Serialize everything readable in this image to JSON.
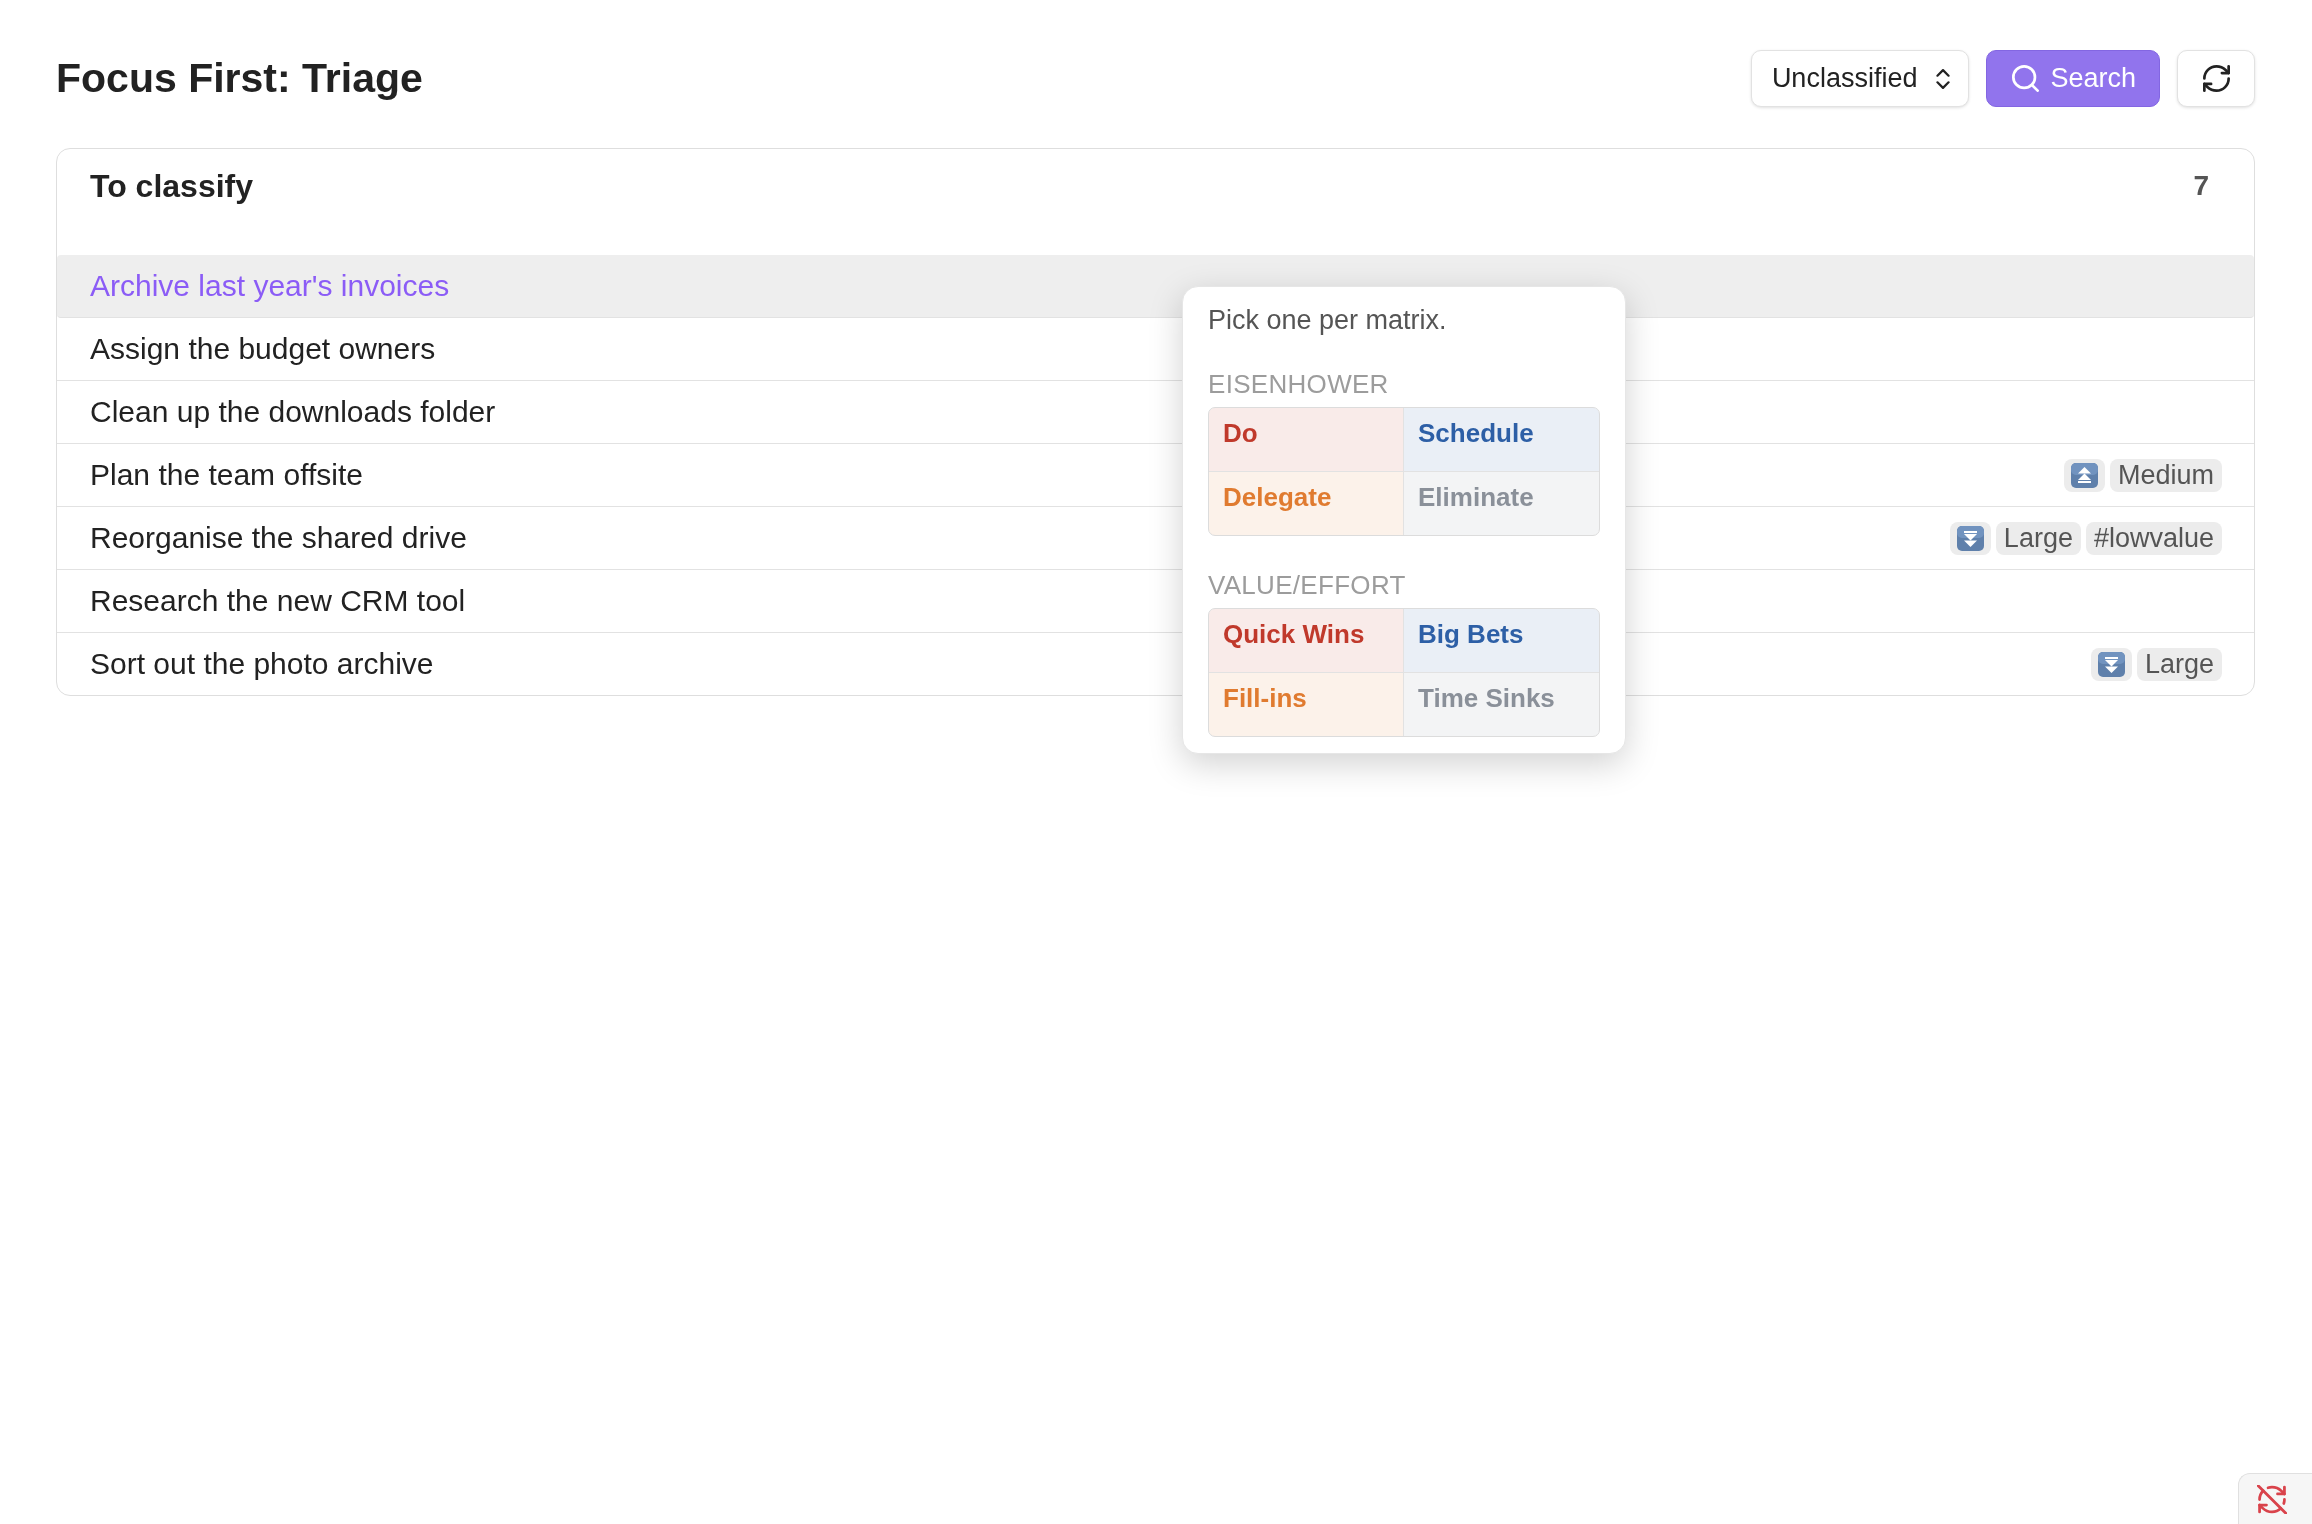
{
  "header": {
    "title": "Focus First: Triage",
    "filter": {
      "value": "Unclassified"
    },
    "search_button": "Search"
  },
  "card": {
    "title": "To classify",
    "count": "7",
    "rows": [
      {
        "title": "Archive last year's invoices",
        "selected": true
      },
      {
        "title": "Assign the budget owners",
        "selected": false
      },
      {
        "title": "Clean up the downloads folder",
        "selected": false
      },
      {
        "title": "Plan the team offsite",
        "selected": false,
        "tags": [
          {
            "kind": "arrow_up"
          },
          {
            "kind": "text",
            "label": "Medium"
          }
        ]
      },
      {
        "title": "Reorganise the shared drive",
        "selected": false,
        "tags": [
          {
            "kind": "arrow_down"
          },
          {
            "kind": "text",
            "label": "Large"
          },
          {
            "kind": "text",
            "label": "#lowvalue"
          }
        ]
      },
      {
        "title": "Research the new CRM tool",
        "selected": false
      },
      {
        "title": "Sort out the photo archive",
        "selected": false,
        "tags": [
          {
            "kind": "arrow_down"
          },
          {
            "kind": "text",
            "label": "Large"
          }
        ]
      }
    ]
  },
  "popup": {
    "hint": "Pick one per matrix.",
    "matrices": [
      {
        "title": "EISENHOWER",
        "options": [
          {
            "label": "Do",
            "color": "#c0392b"
          },
          {
            "label": "Schedule",
            "color": "#2d5fa6"
          },
          {
            "label": "Delegate",
            "color": "#e07b30"
          },
          {
            "label": "Eliminate",
            "color": "#8a9099"
          }
        ]
      },
      {
        "title": "VALUE/EFFORT",
        "options": [
          {
            "label": "Quick Wins",
            "color": "#c0392b"
          },
          {
            "label": "Big Bets",
            "color": "#2d5fa6"
          },
          {
            "label": "Fill-ins",
            "color": "#e07b30"
          },
          {
            "label": "Time Sinks",
            "color": "#8a9099"
          }
        ]
      }
    ]
  }
}
